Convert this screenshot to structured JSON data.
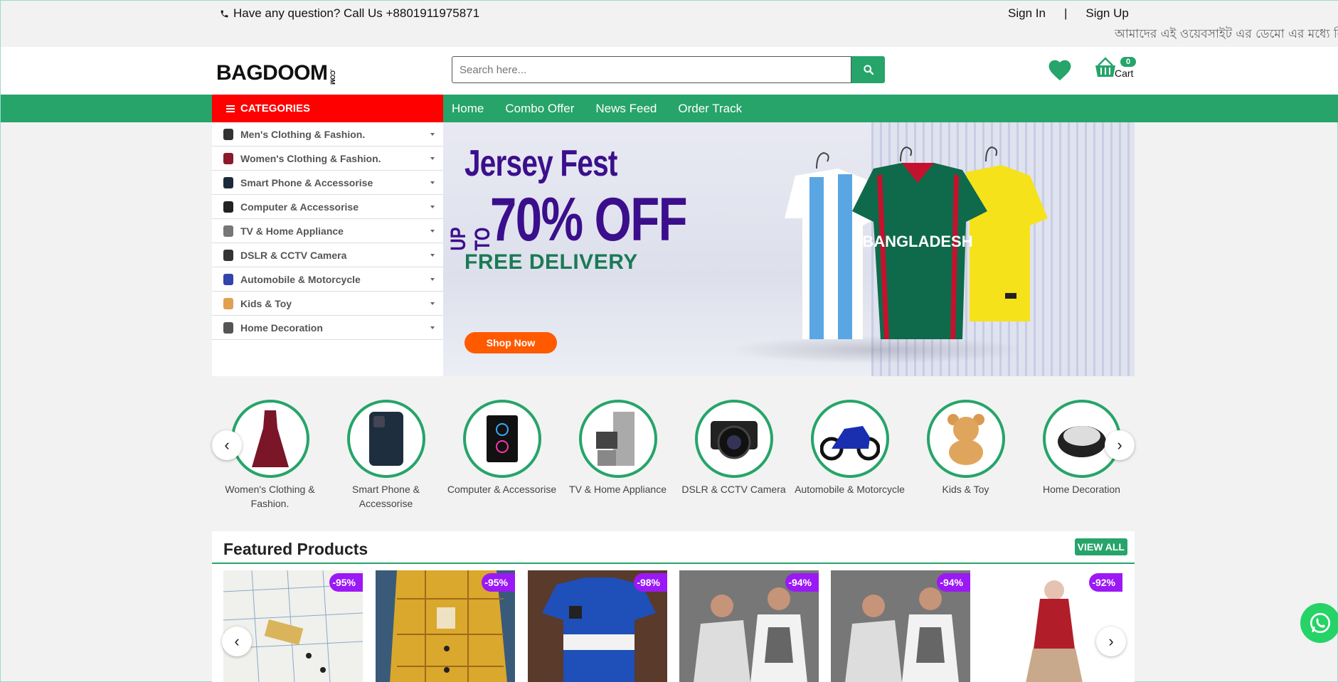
{
  "topbar": {
    "contact": "Have any question? Call Us +8801911975871",
    "sign_in": "Sign In",
    "separator": "|",
    "sign_up": "Sign Up",
    "marquee": "আমাদের এই ওয়েবসাইট এর ডেমো এর মধ্যে বি"
  },
  "header": {
    "logo": "BAGDOOM",
    "logo_suffix": ".COM",
    "search_placeholder": "Search here...",
    "cart_count": "0",
    "cart_label": "Cart"
  },
  "nav": {
    "categories_label": "CATEGORIES",
    "menu": [
      "Home",
      "Combo Offer",
      "News Feed",
      "Order Track"
    ]
  },
  "categories": [
    {
      "label": "Men's Clothing & Fashion.",
      "color": "#333"
    },
    {
      "label": "Women's Clothing & Fashion.",
      "color": "#8b1a2b"
    },
    {
      "label": "Smart Phone & Accessorise",
      "color": "#1c2a3a"
    },
    {
      "label": "Computer & Accessorise",
      "color": "#222"
    },
    {
      "label": "TV & Home Appliance",
      "color": "#777"
    },
    {
      "label": "DSLR & CCTV Camera",
      "color": "#333"
    },
    {
      "label": "Automobile & Motorcycle",
      "color": "#3344aa"
    },
    {
      "label": "Kids & Toy",
      "color": "#e0a050"
    },
    {
      "label": "Home Decoration",
      "color": "#555"
    }
  ],
  "banner": {
    "title": "Jersey Fest",
    "up_to": "UP TO",
    "discount": "70% OFF",
    "free": "FREE DELIVERY",
    "jersey_text": "BANGLADESH",
    "cta": "Shop Now"
  },
  "circles": [
    {
      "label": "Women's Clothing & Fashion."
    },
    {
      "label": "Smart Phone & Accessorise"
    },
    {
      "label": "Computer & Accessorise"
    },
    {
      "label": "TV & Home Appliance"
    },
    {
      "label": "DSLR & CCTV Camera"
    },
    {
      "label": "Automobile & Motorcycle"
    },
    {
      "label": "Kids & Toy"
    },
    {
      "label": "Home Decoration"
    }
  ],
  "featured": {
    "title": "Featured Products",
    "view_all": "VIEW ALL",
    "products": [
      {
        "discount": "-95%"
      },
      {
        "discount": "-95%"
      },
      {
        "discount": "-98%"
      },
      {
        "discount": "-94%"
      },
      {
        "discount": "-94%"
      },
      {
        "discount": "-92%"
      }
    ]
  },
  "arrows": {
    "prev": "‹",
    "next": "›"
  }
}
